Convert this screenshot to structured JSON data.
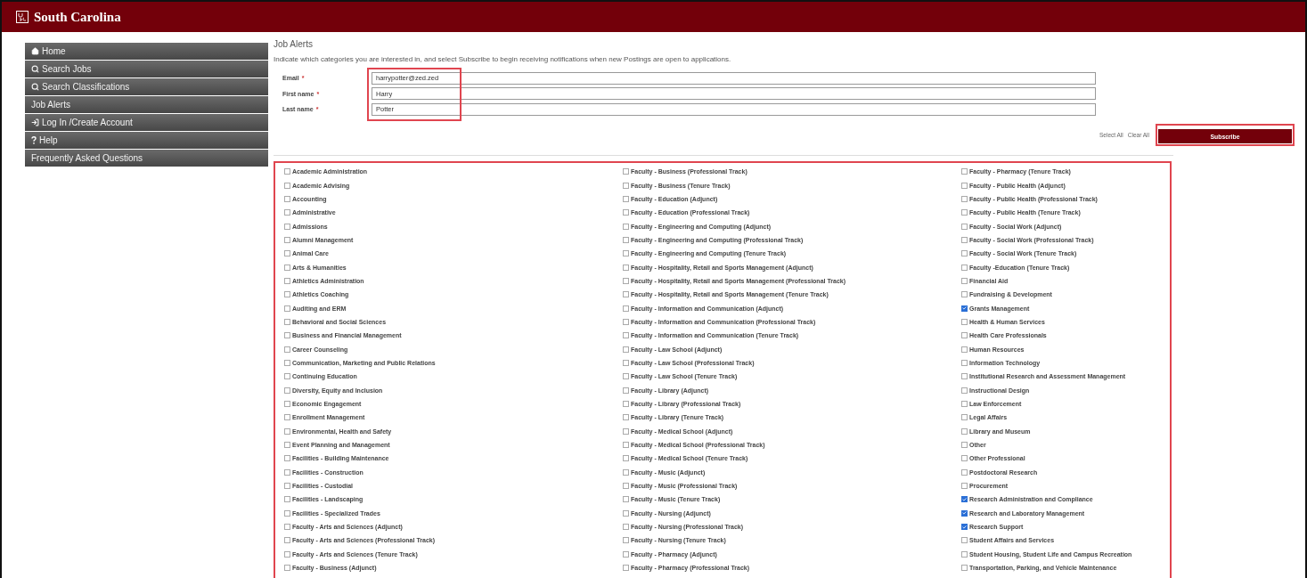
{
  "header": {
    "title": "South Carolina"
  },
  "sidebar": {
    "items": [
      {
        "label": "Home",
        "kind": "home"
      },
      {
        "label": "Search Jobs",
        "kind": "search"
      },
      {
        "label": "Search Classifications",
        "kind": "search"
      },
      {
        "label": "Job Alerts",
        "kind": "plain"
      },
      {
        "label": "Log In /Create Account",
        "kind": "login"
      },
      {
        "label": "Help",
        "kind": "help"
      },
      {
        "label": "Frequently Asked Questions",
        "kind": "plain"
      }
    ]
  },
  "page": {
    "title": "Job Alerts",
    "description": "Indicate which categories you are interested in, and select Subscribe to begin receiving notifications when new Postings are open to applications."
  },
  "fields": [
    {
      "label": "Email",
      "required_mark": "*",
      "value": "harrypotter@zed.zed"
    },
    {
      "label": "First name",
      "required_mark": "*",
      "value": "Harry"
    },
    {
      "label": "Last name",
      "required_mark": "*",
      "value": "Potter"
    }
  ],
  "actions": {
    "select_all": "Select All",
    "clear_all": "Clear All",
    "subscribe": "Subscribe"
  },
  "categories": [
    [
      {
        "label": "Academic Administration",
        "checked": false
      },
      {
        "label": "Academic Advising",
        "checked": false
      },
      {
        "label": "Accounting",
        "checked": false
      },
      {
        "label": "Administrative",
        "checked": false
      },
      {
        "label": "Admissions",
        "checked": false
      },
      {
        "label": "Alumni Management",
        "checked": false
      },
      {
        "label": "Animal Care",
        "checked": false
      },
      {
        "label": "Arts & Humanities",
        "checked": false
      },
      {
        "label": "Athletics Administration",
        "checked": false
      },
      {
        "label": "Athletics Coaching",
        "checked": false
      },
      {
        "label": "Auditing and ERM",
        "checked": false
      },
      {
        "label": "Behavioral and Social Sciences",
        "checked": false
      },
      {
        "label": "Business and Financial Management",
        "checked": false
      },
      {
        "label": "Career Counseling",
        "checked": false
      },
      {
        "label": "Communication, Marketing and Public Relations",
        "checked": false
      },
      {
        "label": "Continuing Education",
        "checked": false
      },
      {
        "label": "Diversity, Equity and Inclusion",
        "checked": false
      },
      {
        "label": "Economic Engagement",
        "checked": false
      },
      {
        "label": "Enrollment Management",
        "checked": false
      },
      {
        "label": "Environmental, Health and Safety",
        "checked": false
      },
      {
        "label": "Event Planning and Management",
        "checked": false
      },
      {
        "label": "Facilities - Building Maintenance",
        "checked": false
      },
      {
        "label": "Facilities - Construction",
        "checked": false
      },
      {
        "label": "Facilities - Custodial",
        "checked": false
      },
      {
        "label": "Facilities - Landscaping",
        "checked": false
      },
      {
        "label": "Facilities - Specialized Trades",
        "checked": false
      },
      {
        "label": "Faculty - Arts and Sciences (Adjunct)",
        "checked": false
      },
      {
        "label": "Faculty - Arts and Sciences (Professional Track)",
        "checked": false
      },
      {
        "label": "Faculty - Arts and Sciences (Tenure Track)",
        "checked": false
      },
      {
        "label": "Faculty - Business (Adjunct)",
        "checked": false
      }
    ],
    [
      {
        "label": "Faculty - Business (Professional Track)",
        "checked": false
      },
      {
        "label": "Faculty - Business (Tenure Track)",
        "checked": false
      },
      {
        "label": "Faculty - Education (Adjunct)",
        "checked": false
      },
      {
        "label": "Faculty - Education (Professional Track)",
        "checked": false
      },
      {
        "label": "Faculty - Engineering and Computing (Adjunct)",
        "checked": false
      },
      {
        "label": "Faculty - Engineering and Computing (Professional Track)",
        "checked": false
      },
      {
        "label": "Faculty - Engineering and Computing (Tenure Track)",
        "checked": false
      },
      {
        "label": "Faculty - Hospitality, Retail and Sports Management (Adjunct)",
        "checked": false
      },
      {
        "label": "Faculty - Hospitality, Retail and Sports Management (Professional Track)",
        "checked": false
      },
      {
        "label": "Faculty - Hospitality, Retail and Sports Management (Tenure Track)",
        "checked": false
      },
      {
        "label": "Faculty - Information and Communication (Adjunct)",
        "checked": false
      },
      {
        "label": "Faculty - Information and Communication (Professional Track)",
        "checked": false
      },
      {
        "label": "Faculty - Information and Communication (Tenure Track)",
        "checked": false
      },
      {
        "label": "Faculty - Law School (Adjunct)",
        "checked": false
      },
      {
        "label": "Faculty - Law School (Professional Track)",
        "checked": false
      },
      {
        "label": "Faculty - Law School (Tenure Track)",
        "checked": false
      },
      {
        "label": "Faculty - Library (Adjunct)",
        "checked": false
      },
      {
        "label": "Faculty - Library (Professional Track)",
        "checked": false
      },
      {
        "label": "Faculty - Library (Tenure Track)",
        "checked": false
      },
      {
        "label": "Faculty - Medical School (Adjunct)",
        "checked": false
      },
      {
        "label": "Faculty - Medical School (Professional Track)",
        "checked": false
      },
      {
        "label": "Faculty - Medical School (Tenure Track)",
        "checked": false
      },
      {
        "label": "Faculty - Music (Adjunct)",
        "checked": false
      },
      {
        "label": "Faculty - Music (Professional Track)",
        "checked": false
      },
      {
        "label": "Faculty - Music (Tenure Track)",
        "checked": false
      },
      {
        "label": "Faculty - Nursing (Adjunct)",
        "checked": false
      },
      {
        "label": "Faculty - Nursing (Professional Track)",
        "checked": false
      },
      {
        "label": "Faculty - Nursing (Tenure Track)",
        "checked": false
      },
      {
        "label": "Faculty - Pharmacy (Adjunct)",
        "checked": false
      },
      {
        "label": "Faculty - Pharmacy (Professional Track)",
        "checked": false
      }
    ],
    [
      {
        "label": "Faculty - Pharmacy (Tenure Track)",
        "checked": false
      },
      {
        "label": "Faculty - Public Health (Adjunct)",
        "checked": false
      },
      {
        "label": "Faculty - Public Health (Professional Track)",
        "checked": false
      },
      {
        "label": "Faculty - Public Health (Tenure Track)",
        "checked": false
      },
      {
        "label": "Faculty - Social Work (Adjunct)",
        "checked": false
      },
      {
        "label": "Faculty - Social Work (Professional Track)",
        "checked": false
      },
      {
        "label": "Faculty - Social Work (Tenure Track)",
        "checked": false
      },
      {
        "label": "Faculty -Education (Tenure Track)",
        "checked": false
      },
      {
        "label": "Financial Aid",
        "checked": false
      },
      {
        "label": "Fundraising & Development",
        "checked": false
      },
      {
        "label": "Grants Management",
        "checked": true
      },
      {
        "label": "Health & Human Services",
        "checked": false
      },
      {
        "label": "Health Care Professionals",
        "checked": false
      },
      {
        "label": "Human Resources",
        "checked": false
      },
      {
        "label": "Information Technology",
        "checked": false
      },
      {
        "label": "Institutional Research and Assessment Management",
        "checked": false
      },
      {
        "label": "Instructional Design",
        "checked": false
      },
      {
        "label": "Law Enforcement",
        "checked": false
      },
      {
        "label": "Legal Affairs",
        "checked": false
      },
      {
        "label": "Library and Museum",
        "checked": false
      },
      {
        "label": "Other",
        "checked": false
      },
      {
        "label": "Other Professional",
        "checked": false
      },
      {
        "label": "Postdoctoral Research",
        "checked": false
      },
      {
        "label": "Procurement",
        "checked": false
      },
      {
        "label": "Research Administration and Compliance",
        "checked": true
      },
      {
        "label": "Research and Laboratory Management",
        "checked": true
      },
      {
        "label": "Research Support",
        "checked": true
      },
      {
        "label": "Student Affairs and Services",
        "checked": false
      },
      {
        "label": "Student Housing, Student Life and Campus Recreation",
        "checked": false
      },
      {
        "label": "Transportation, Parking, and Vehicle Maintenance",
        "checked": false
      }
    ]
  ]
}
